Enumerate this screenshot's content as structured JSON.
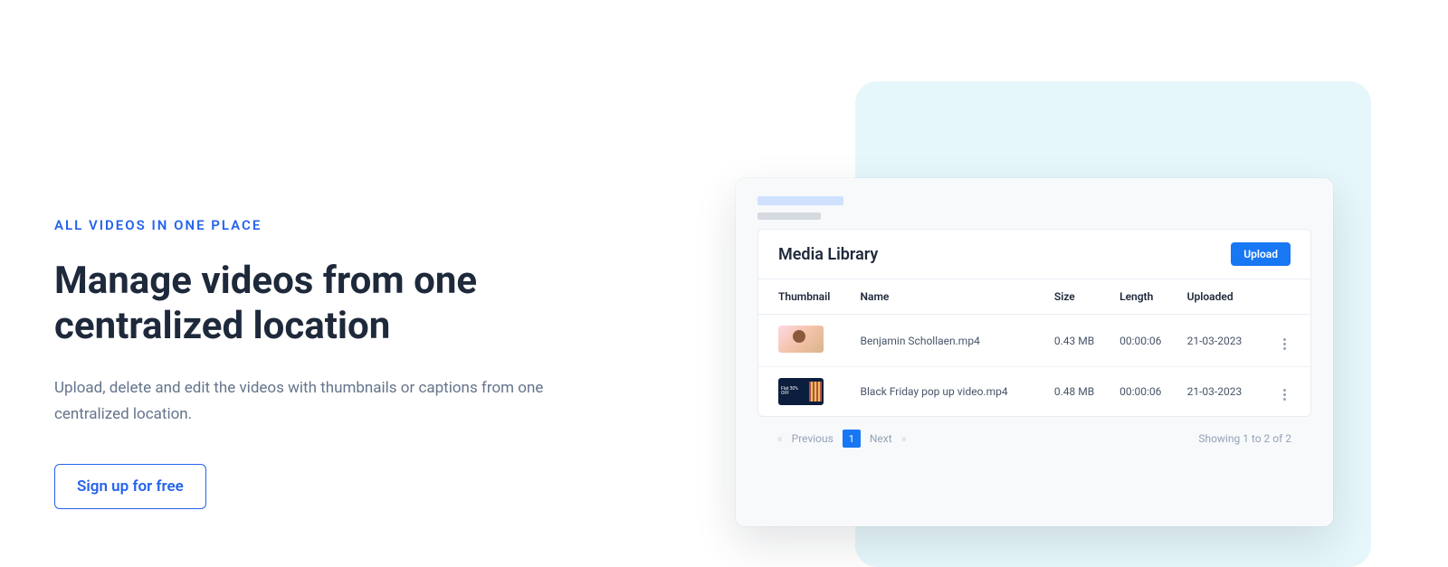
{
  "left": {
    "eyebrow": "ALL VIDEOS IN ONE PLACE",
    "headline": "Manage videos from one centralized location",
    "sub": "Upload, delete and edit the videos with thumbnails or captions from one centralized location.",
    "cta": "Sign up for free"
  },
  "media": {
    "title": "Media Library",
    "upload_label": "Upload",
    "columns": {
      "thumb": "Thumbnail",
      "name": "Name",
      "size": "Size",
      "length": "Length",
      "uploaded": "Uploaded"
    },
    "rows": [
      {
        "name": "Benjamin Schollaen.mp4",
        "size": "0.43 MB",
        "length": "00:00:06",
        "uploaded": "21-03-2023",
        "thumb_class": "thumb1"
      },
      {
        "name": "Black Friday pop up video.mp4",
        "size": "0.48 MB",
        "length": "00:00:06",
        "uploaded": "21-03-2023",
        "thumb_class": "thumb2"
      }
    ],
    "pagination": {
      "prev": "Previous",
      "next": "Next",
      "current": "1",
      "summary": "Showing 1 to 2 of 2"
    }
  }
}
